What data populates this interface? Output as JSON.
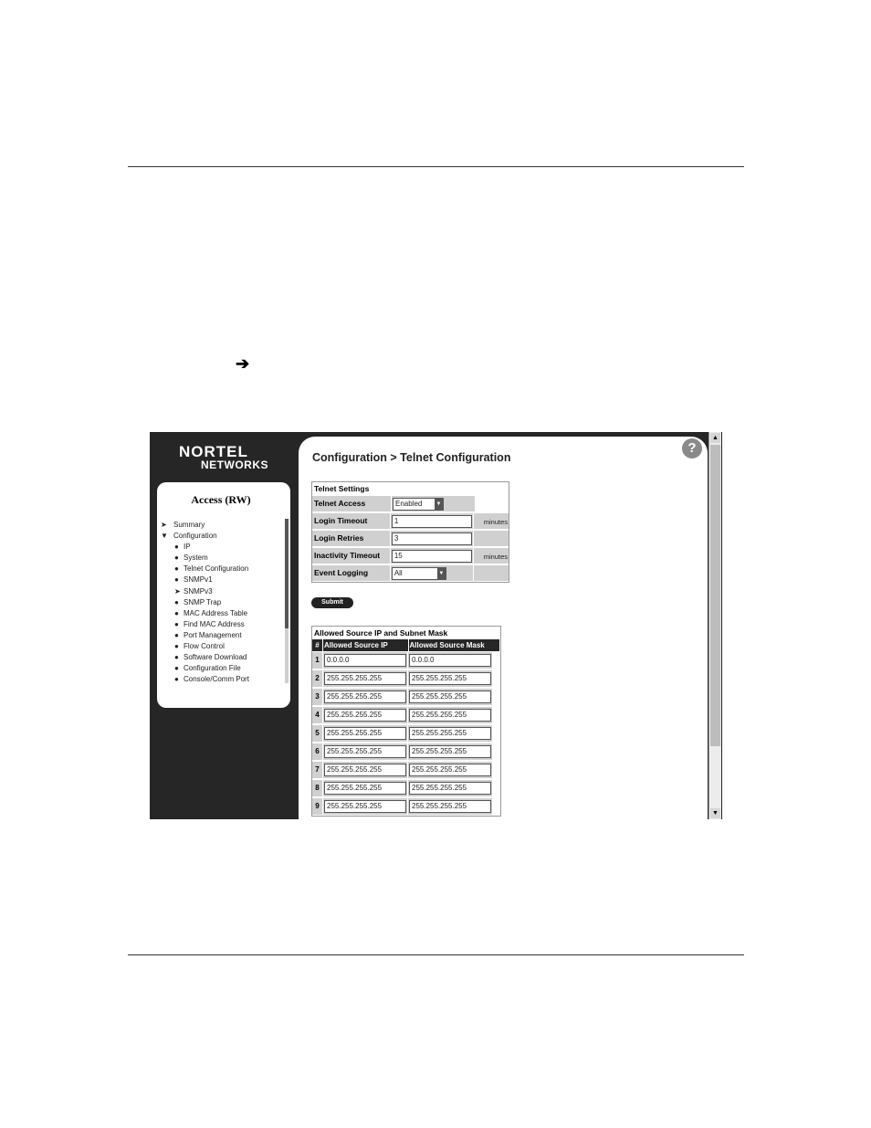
{
  "document": {
    "arrow_glyph": "➔"
  },
  "app": {
    "logo_line1": "NORTEL",
    "logo_line2": "NETWORKS",
    "access_label": "Access (RW)",
    "breadcrumb": "Configuration > Telnet Configuration",
    "help_glyph": "?"
  },
  "nav": {
    "items": [
      {
        "label": "Summary",
        "level": "top",
        "marker": "➤"
      },
      {
        "label": "Configuration",
        "level": "top",
        "marker": "▼"
      },
      {
        "label": "IP",
        "level": "sub",
        "marker": "●"
      },
      {
        "label": "System",
        "level": "sub",
        "marker": "●"
      },
      {
        "label": "Telnet Configuration",
        "level": "sub",
        "marker": "●"
      },
      {
        "label": "SNMPv1",
        "level": "sub",
        "marker": "●"
      },
      {
        "label": "SNMPv3",
        "level": "sub",
        "marker": "➤"
      },
      {
        "label": "SNMP Trap",
        "level": "sub",
        "marker": "●"
      },
      {
        "label": "MAC Address Table",
        "level": "sub",
        "marker": "●"
      },
      {
        "label": "Find MAC Address",
        "level": "sub",
        "marker": "●"
      },
      {
        "label": "Port Management",
        "level": "sub",
        "marker": "●"
      },
      {
        "label": "Flow Control",
        "level": "sub",
        "marker": "●"
      },
      {
        "label": "Software Download",
        "level": "sub",
        "marker": "●"
      },
      {
        "label": "Configuration File",
        "level": "sub",
        "marker": "●"
      },
      {
        "label": "Console/Comm Port",
        "level": "sub",
        "marker": "●"
      }
    ]
  },
  "telnet_settings": {
    "title": "Telnet Settings",
    "access_label": "Telnet Access",
    "access_value": "Enabled",
    "login_timeout_label": "Login Timeout",
    "login_timeout_value": "1",
    "login_timeout_unit": "minutes",
    "login_retries_label": "Login Retries",
    "login_retries_value": "3",
    "inactivity_label": "Inactivity Timeout",
    "inactivity_value": "15",
    "inactivity_unit": "minutes",
    "logging_label": "Event Logging",
    "logging_value": "All"
  },
  "submit_label": "Submit",
  "allowed": {
    "title": "Allowed Source IP and Subnet Mask",
    "col_index": "#",
    "col_ip": "Allowed Source IP",
    "col_mask": "Allowed Source Mask",
    "rows": [
      {
        "n": "1",
        "ip": "0.0.0.0",
        "mask": "0.0.0.0"
      },
      {
        "n": "2",
        "ip": "255.255.255.255",
        "mask": "255.255.255.255"
      },
      {
        "n": "3",
        "ip": "255.255.255.255",
        "mask": "255.255.255.255"
      },
      {
        "n": "4",
        "ip": "255.255.255.255",
        "mask": "255.255.255.255"
      },
      {
        "n": "5",
        "ip": "255.255.255.255",
        "mask": "255.255.255.255"
      },
      {
        "n": "6",
        "ip": "255.255.255.255",
        "mask": "255.255.255.255"
      },
      {
        "n": "7",
        "ip": "255.255.255.255",
        "mask": "255.255.255.255"
      },
      {
        "n": "8",
        "ip": "255.255.255.255",
        "mask": "255.255.255.255"
      },
      {
        "n": "9",
        "ip": "255.255.255.255",
        "mask": "255.255.255.255"
      }
    ]
  }
}
